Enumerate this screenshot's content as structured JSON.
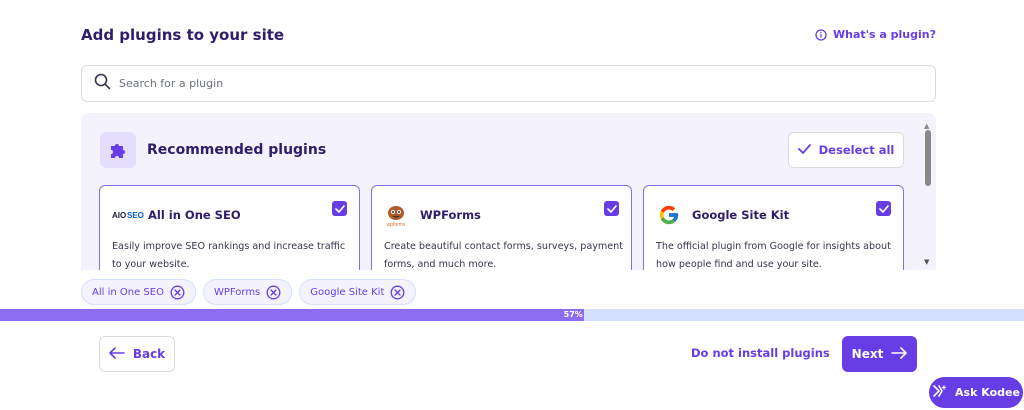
{
  "page": {
    "title": "Add plugins to your site",
    "help_link": "What's a plugin?"
  },
  "search": {
    "placeholder": "Search for a plugin",
    "value": ""
  },
  "recommended": {
    "title": "Recommended plugins",
    "deselect_label": "Deselect all",
    "plugins": [
      {
        "name": "All in One SEO",
        "logo_text": "AIOSEO",
        "description": "Easily improve SEO rankings and increase traffic to your website.",
        "checked": true,
        "icon": "aioseo-logo-icon"
      },
      {
        "name": "WPForms",
        "logo_text": "wpforms",
        "description": "Create beautiful contact forms, surveys, payment forms, and much more.",
        "checked": true,
        "icon": "wpforms-logo-icon"
      },
      {
        "name": "Google Site Kit",
        "logo_text": "",
        "description": "The official plugin from Google for insights about how people find and use your site.",
        "checked": true,
        "icon": "google-logo-icon"
      }
    ]
  },
  "selected_chips": [
    {
      "label": "All in One SEO"
    },
    {
      "label": "WPForms"
    },
    {
      "label": "Google Site Kit"
    }
  ],
  "progress": {
    "percent": 57,
    "label": "57%"
  },
  "footer": {
    "back_label": "Back",
    "skip_label": "Do not install plugins",
    "next_label": "Next"
  },
  "assistant": {
    "label": "Ask Kodee"
  },
  "colors": {
    "accent": "#673de6",
    "accent_light": "#8c6cf0",
    "panel_bg": "#f4f3fd",
    "title": "#2f1c6a"
  }
}
